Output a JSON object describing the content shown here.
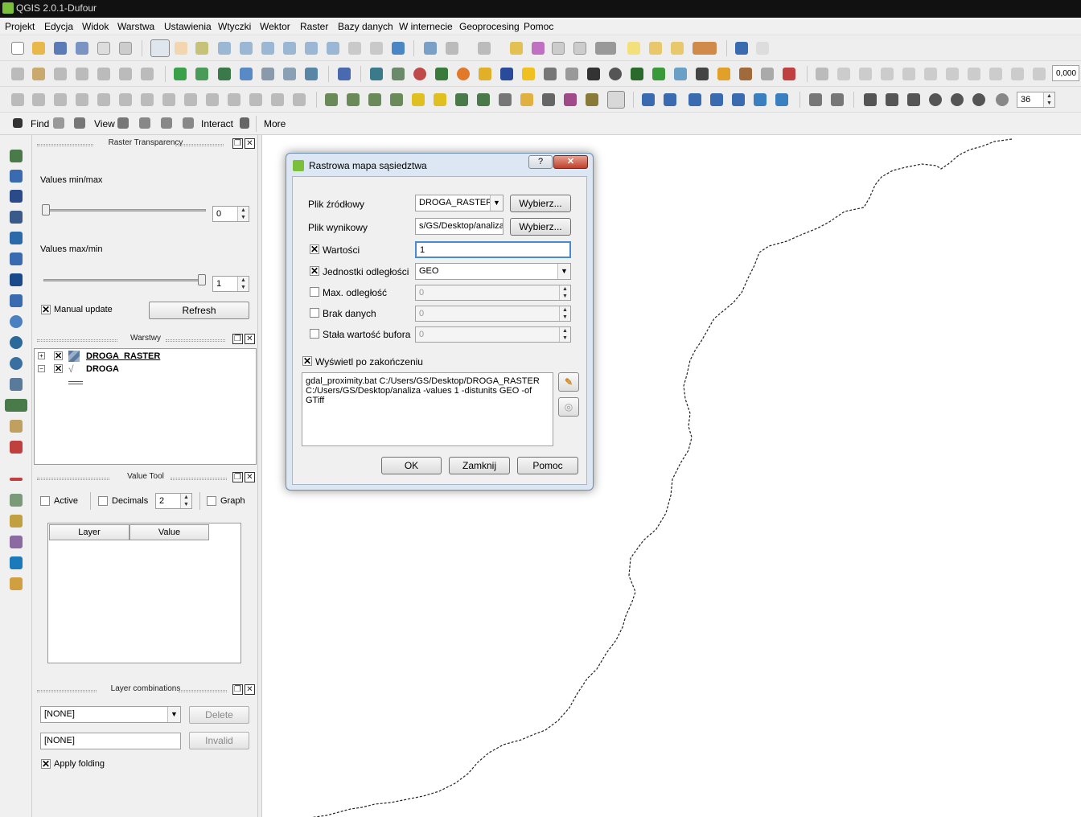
{
  "window": {
    "title": "QGIS 2.0.1-Dufour"
  },
  "menu": [
    "Projekt",
    "Edycja",
    "Widok",
    "Warstwa",
    "Ustawienia",
    "Wtyczki",
    "Wektor",
    "Raster",
    "Bazy danych",
    "W internecie",
    "Geoprocesing",
    "Pomoc"
  ],
  "toolbar": {
    "scale_value": "0,000",
    "size_value": "36"
  },
  "searchbar": {
    "find_label": "Find",
    "view_label": "View",
    "interact_label": "Interact",
    "more_label": "More"
  },
  "raster_transparency": {
    "title": "Raster Transparency",
    "min_max_label": "Values min/max",
    "min_value": "0",
    "max_min_label": "Values max/min",
    "max_value": "1",
    "manual_update_label": "Manual update",
    "refresh_label": "Refresh"
  },
  "layers_panel": {
    "title": "Warstwy",
    "layers": [
      {
        "name": "DROGA_RASTER"
      },
      {
        "name": "DROGA"
      }
    ]
  },
  "value_tool": {
    "title": "Value Tool",
    "active_label": "Active",
    "decimals_label": "Decimals",
    "decimals_value": "2",
    "graph_label": "Graph",
    "columns": [
      "Layer",
      "Value"
    ]
  },
  "layer_combinations": {
    "title": "Layer combinations",
    "combo_value": "[NONE]",
    "name_value": "[NONE]",
    "delete_label": "Delete",
    "invalid_label": "Invalid",
    "apply_folding_label": "Apply folding"
  },
  "dialog": {
    "title": "Rastrowa mapa sąsiedztwa",
    "help_label": "?",
    "close_label": "✕",
    "source_label": "Plik źródłowy",
    "source_value": "DROGA_RASTER",
    "browse_label": "Wybierz...",
    "output_label": "Plik wynikowy",
    "output_value": "s/GS/Desktop/analiza",
    "values_label": "Wartości",
    "values_value": "1",
    "distunits_label": "Jednostki odległości",
    "distunits_value": "GEO",
    "maxdist_label": "Max. odległość",
    "maxdist_value": "0",
    "nodata_label": "Brak danych",
    "nodata_value": "0",
    "buffer_label": "Stała wartość bufora",
    "buffer_value": "0",
    "show_after_label": "Wyświetl po zakończeniu",
    "command_line1": "gdal_proximity.bat C:/Users/GS/Desktop/DROGA_RASTER",
    "command_line2": "C:/Users/GS/Desktop/analiza -values 1 -distunits GEO -of GTiff",
    "ok_label": "OK",
    "close_button_label": "Zamknij",
    "help_button_label": "Pomoc"
  }
}
